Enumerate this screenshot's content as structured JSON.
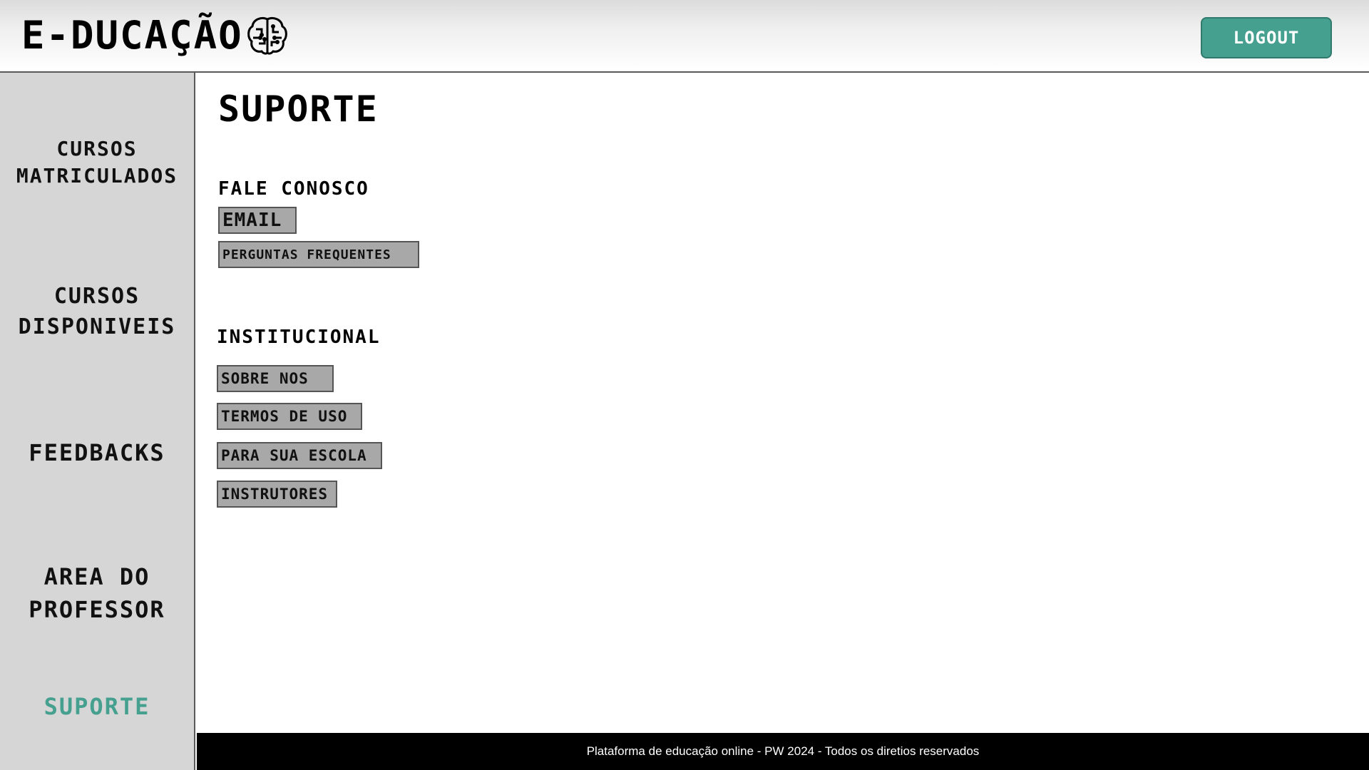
{
  "header": {
    "logo_text": "E-DUCAÇÃO",
    "logo_icon": "brain-icon",
    "logout_label": "LOGOUT"
  },
  "sidebar": {
    "items": [
      {
        "line1": "CURSOS",
        "line2": "MATRICULADOS"
      },
      {
        "line1": "CURSOS",
        "line2": "DISPONIVEIS"
      },
      {
        "line1": "FEEDBACKS",
        "line2": ""
      },
      {
        "line1": "AREA DO",
        "line2": "PROFESSOR"
      },
      {
        "line1": "SUPORTE",
        "line2": ""
      }
    ]
  },
  "main": {
    "title": "SUPORTE",
    "contact": {
      "title": "FALE CONOSCO",
      "links": [
        "EMAIL",
        "PERGUNTAS FREQUENTES"
      ]
    },
    "institutional": {
      "title": "INSTITUCIONAL",
      "links": [
        "SOBRE NOS",
        "TERMOS DE USO",
        "PARA SUA ESCOLA",
        "INSTRUTORES"
      ]
    }
  },
  "footer": {
    "text": "Plataforma de educação online - PW 2024 - Todos os diretios reservados"
  },
  "colors": {
    "accent": "#46a08f",
    "sidebar_bg": "#d6d6d6",
    "button_bg": "#a8a8a8",
    "footer_bg": "#000000"
  }
}
